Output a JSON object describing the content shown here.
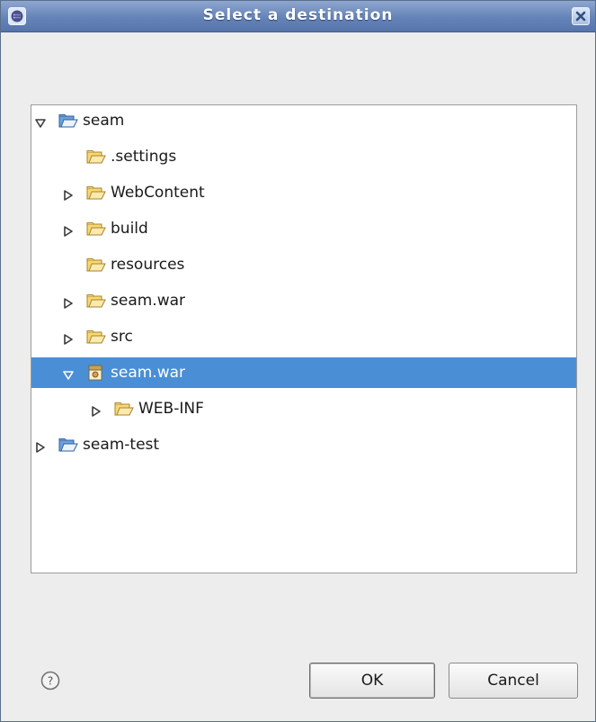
{
  "window": {
    "title": "Select a destination"
  },
  "tree": {
    "rows": [
      {
        "label": "seam",
        "twisty": "expanded",
        "icon": "project-folder-icon",
        "depth": 0,
        "selected": false
      },
      {
        "label": ".settings",
        "twisty": "none",
        "icon": "folder-icon",
        "depth": 1,
        "selected": false
      },
      {
        "label": "WebContent",
        "twisty": "collapsed",
        "icon": "folder-icon",
        "depth": 1,
        "selected": false
      },
      {
        "label": "build",
        "twisty": "collapsed",
        "icon": "folder-icon",
        "depth": 1,
        "selected": false
      },
      {
        "label": "resources",
        "twisty": "none",
        "icon": "folder-icon",
        "depth": 1,
        "selected": false
      },
      {
        "label": "seam.war",
        "twisty": "collapsed",
        "icon": "folder-icon",
        "depth": 1,
        "selected": false
      },
      {
        "label": "src",
        "twisty": "collapsed",
        "icon": "folder-icon",
        "depth": 1,
        "selected": false
      },
      {
        "label": "seam.war",
        "twisty": "expanded",
        "icon": "war-archive-icon",
        "depth": 1,
        "selected": true
      },
      {
        "label": "WEB-INF",
        "twisty": "collapsed",
        "icon": "folder-icon",
        "depth": 2,
        "selected": false
      },
      {
        "label": "seam-test",
        "twisty": "collapsed",
        "icon": "project-folder-icon",
        "depth": 0,
        "selected": false
      }
    ]
  },
  "footer": {
    "ok_label": "OK",
    "cancel_label": "Cancel"
  },
  "colors": {
    "selection": "#4a8fd6",
    "titlebar": "#6483b8"
  }
}
